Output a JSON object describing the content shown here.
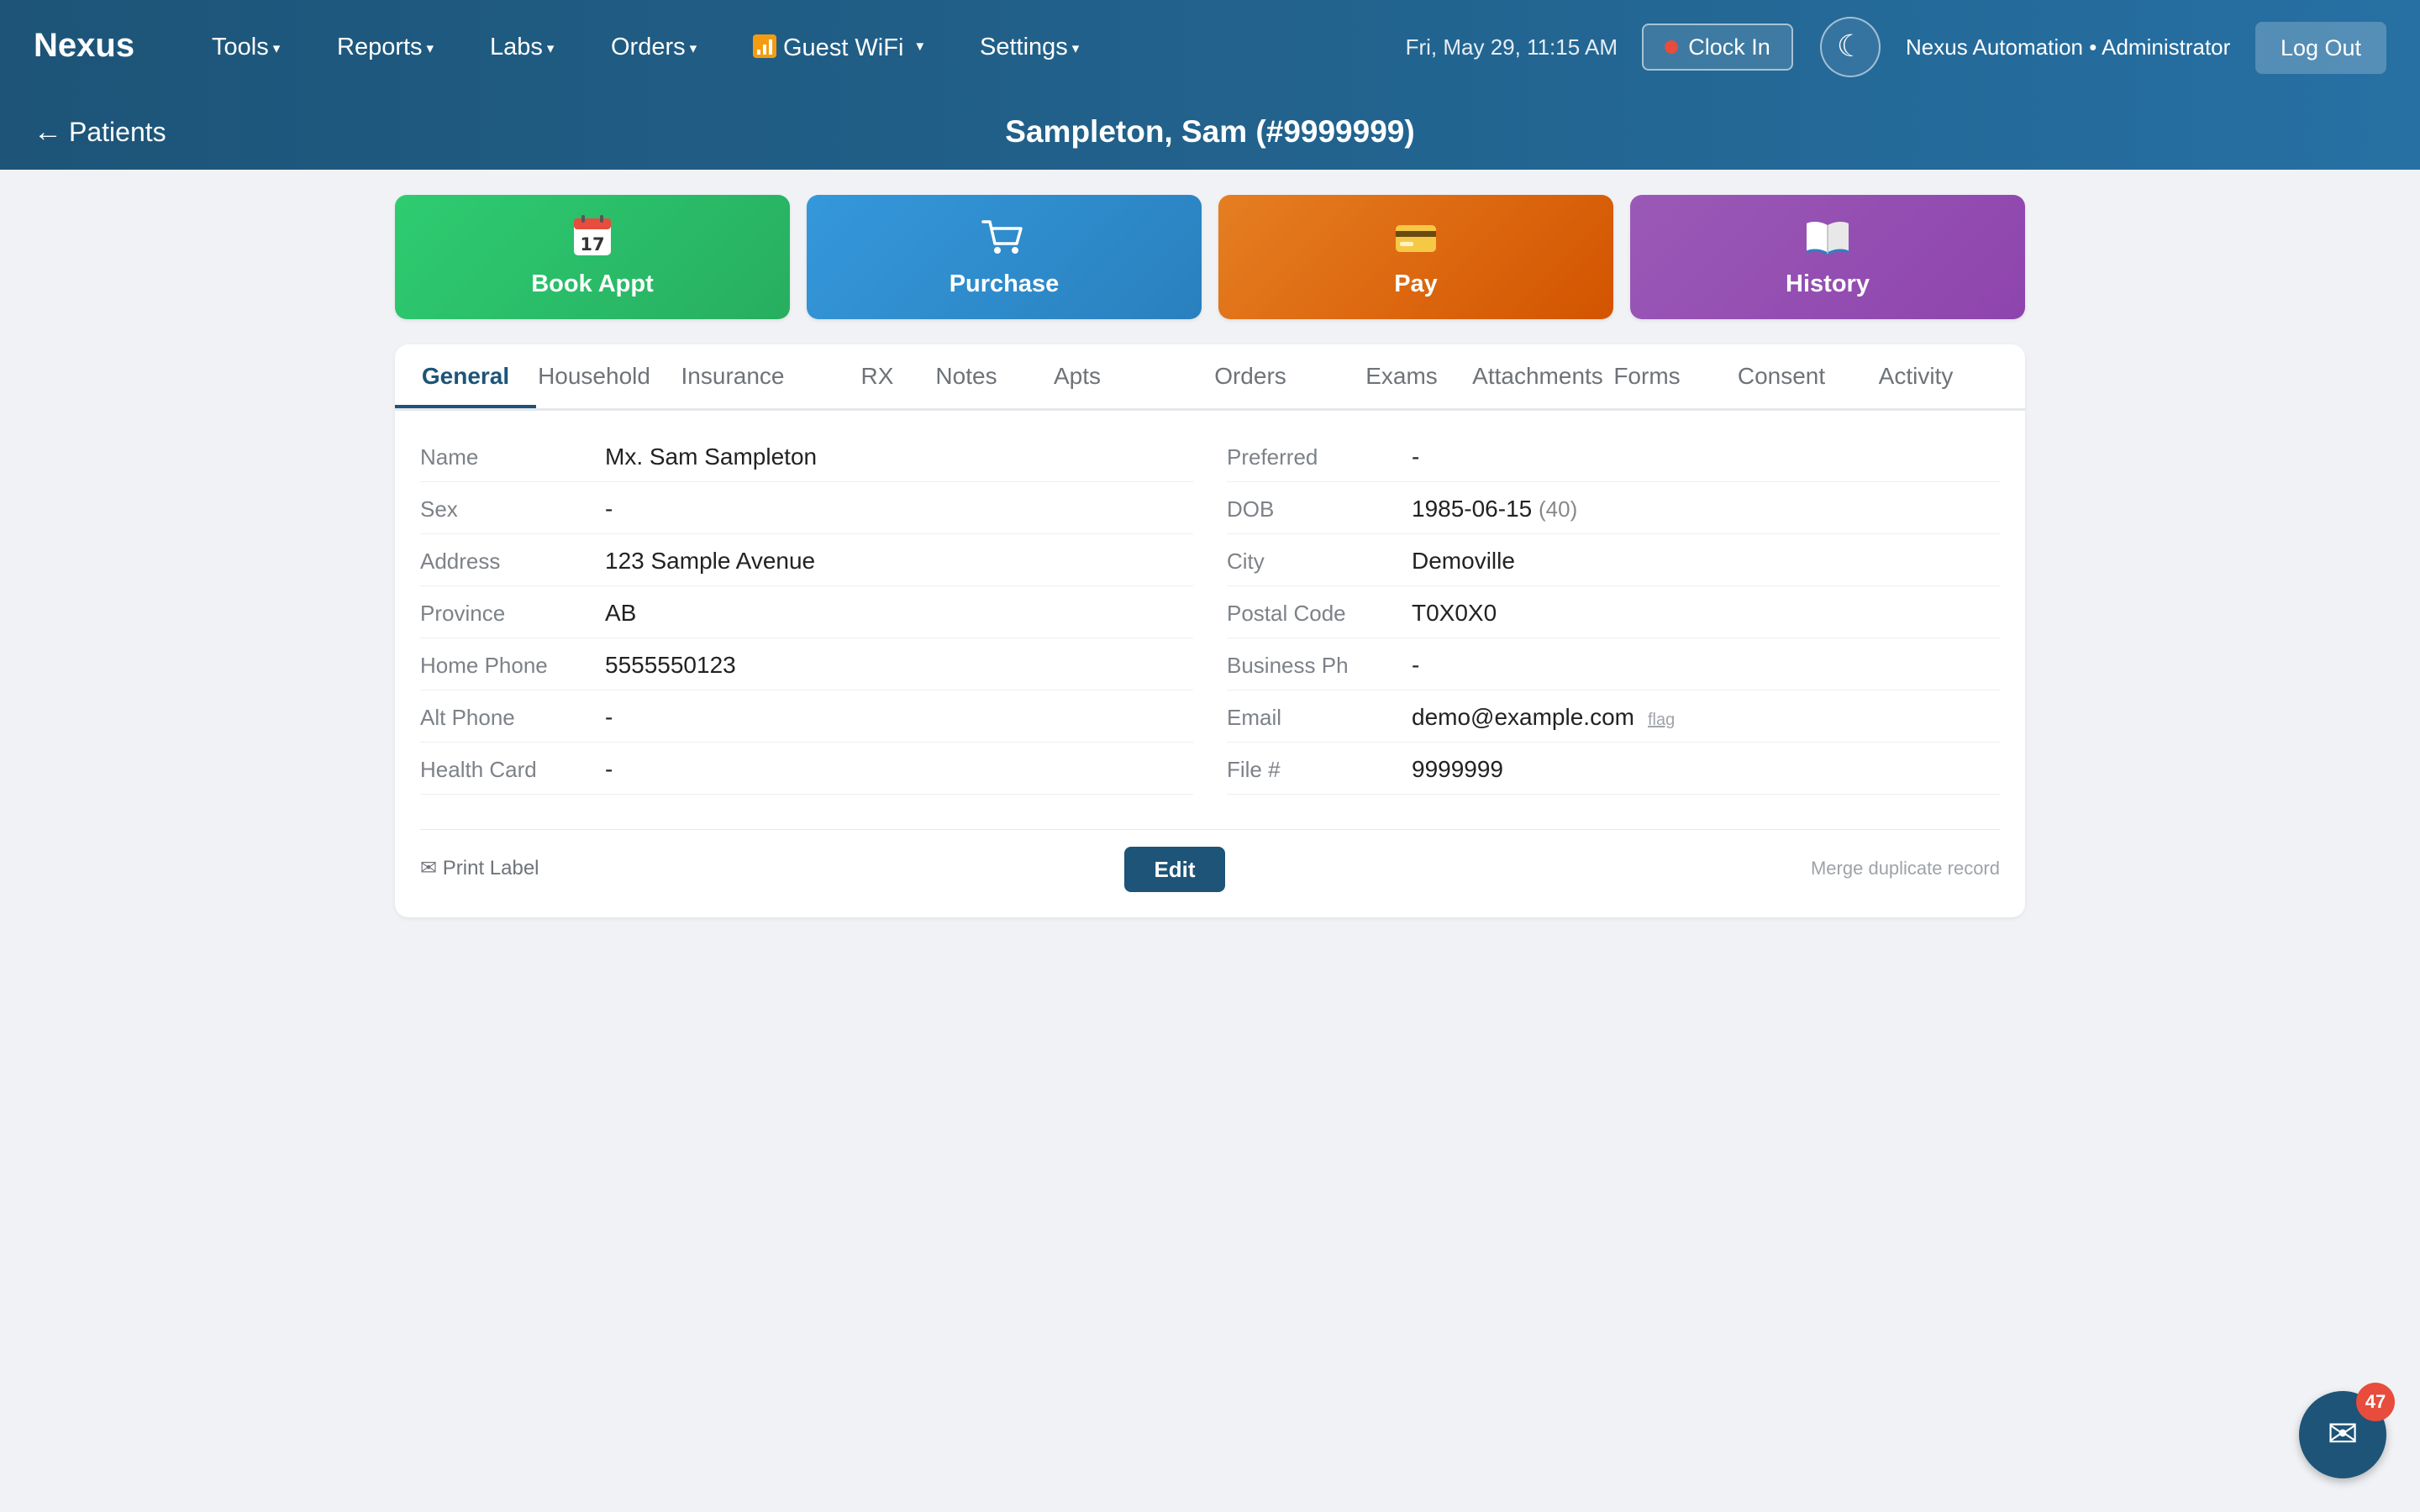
{
  "app": {
    "brand": "Nexus"
  },
  "nav": {
    "items": [
      {
        "label": "Tools"
      },
      {
        "label": "Reports"
      },
      {
        "label": "Labs"
      },
      {
        "label": "Orders"
      },
      {
        "label": "Guest WiFi",
        "icon": "wifi-icon"
      },
      {
        "label": "Settings"
      }
    ],
    "datetime": "Fri, May 29, 11:15 AM",
    "clock_in_label": "Clock In",
    "theme_icon": "moon-icon",
    "user_label": "Nexus Automation • Administrator",
    "logout_label": "Log Out"
  },
  "subheader": {
    "back_label": "Patients",
    "patient_title": "Sampleton, Sam (#9999999)"
  },
  "actions": [
    {
      "label": "Book Appt",
      "icon": "calendar-icon",
      "color": "#2ecc71"
    },
    {
      "label": "Purchase",
      "icon": "cart-icon",
      "color": "#3498db"
    },
    {
      "label": "Pay",
      "icon": "credit-card-icon",
      "color": "#e67e22"
    },
    {
      "label": "History",
      "icon": "book-icon",
      "color": "#9b59b6"
    }
  ],
  "tabs": [
    {
      "label": "General",
      "active": true
    },
    {
      "label": "Household"
    },
    {
      "label": "Insurance"
    },
    {
      "label": "RX"
    },
    {
      "label": "Notes"
    },
    {
      "label": "Apts"
    },
    {
      "label": "Orders"
    },
    {
      "label": "Exams"
    },
    {
      "label": "Attachments"
    },
    {
      "label": "Forms"
    },
    {
      "label": "Consent"
    },
    {
      "label": "Activity"
    }
  ],
  "fields_left": [
    {
      "label": "Name",
      "value": "Mx. Sam Sampleton"
    },
    {
      "label": "Sex",
      "value": "-"
    },
    {
      "label": "Address",
      "value": "123 Sample Avenue"
    },
    {
      "label": "Province",
      "value": "AB"
    },
    {
      "label": "Home Phone",
      "value": "5555550123"
    },
    {
      "label": "Alt Phone",
      "value": "-"
    },
    {
      "label": "Health Card",
      "value": "-"
    }
  ],
  "fields_right": [
    {
      "label": "Preferred",
      "value": "-"
    },
    {
      "label": "DOB",
      "value": "1985-06-15",
      "extra": "(40)"
    },
    {
      "label": "City",
      "value": "Demoville"
    },
    {
      "label": "Postal Code",
      "value": "T0X0X0"
    },
    {
      "label": "Business Ph",
      "value": "-"
    },
    {
      "label": "Email",
      "value": "demo@example.com",
      "extra": "flag"
    },
    {
      "label": "File #",
      "value": "9999999"
    }
  ],
  "footer": {
    "print_label": "✉ Print Label",
    "edit_label": "Edit",
    "merge_label": "Merge duplicate record"
  },
  "chat": {
    "icon": "mail-icon",
    "badge_count": "47"
  },
  "colors": {
    "primary": "#1d5478",
    "accent_red": "#e74c3c"
  }
}
